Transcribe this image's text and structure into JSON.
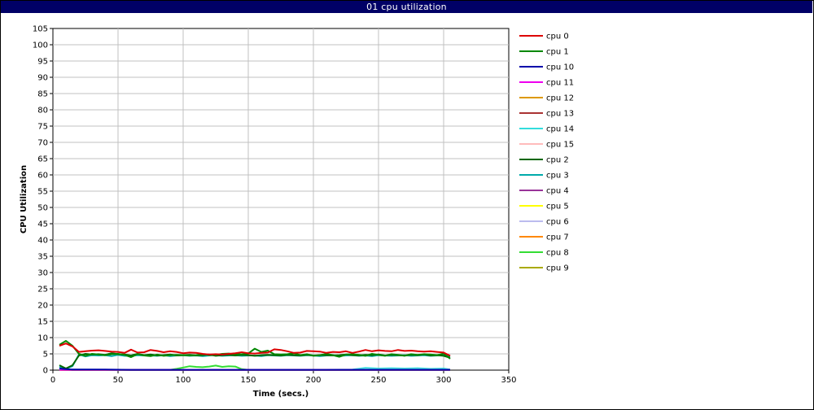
{
  "window": {
    "title": "01 cpu utilization"
  },
  "chart_data": {
    "type": "line",
    "title": "01 cpu utilization",
    "xlabel": "Time (secs.)",
    "ylabel": "CPU Utilization",
    "xlim": [
      0,
      350
    ],
    "ylim": [
      0,
      105
    ],
    "xticks": [
      0,
      50,
      100,
      150,
      200,
      250,
      300,
      350
    ],
    "yticks": [
      0,
      5,
      10,
      15,
      20,
      25,
      30,
      35,
      40,
      45,
      50,
      55,
      60,
      65,
      70,
      75,
      80,
      85,
      90,
      95,
      100,
      105
    ],
    "grid": true,
    "legend_position": "right",
    "series": [
      {
        "name": "cpu 0",
        "color": "#dd0000",
        "x": [
          5,
          10,
          15,
          20,
          25,
          30,
          35,
          40,
          45,
          50,
          55,
          60,
          65,
          70,
          75,
          80,
          85,
          90,
          95,
          100,
          105,
          110,
          115,
          120,
          125,
          130,
          135,
          140,
          145,
          150,
          155,
          160,
          165,
          170,
          175,
          180,
          185,
          190,
          195,
          200,
          205,
          210,
          215,
          220,
          225,
          230,
          235,
          240,
          245,
          250,
          255,
          260,
          265,
          270,
          275,
          280,
          285,
          290,
          295,
          300,
          305
        ],
        "y": [
          7.5,
          8.2,
          7.3,
          5.6,
          5.8,
          6.0,
          6.1,
          5.9,
          5.7,
          5.6,
          5.3,
          6.3,
          5.4,
          5.5,
          6.2,
          5.9,
          5.5,
          5.8,
          5.6,
          5.2,
          5.4,
          5.3,
          5.0,
          4.8,
          4.9,
          4.8,
          5.0,
          5.2,
          5.5,
          5.2,
          5.1,
          5.3,
          5.4,
          6.4,
          6.2,
          5.8,
          5.3,
          5.4,
          5.9,
          5.8,
          5.7,
          5.3,
          5.6,
          5.5,
          5.8,
          5.3,
          5.7,
          6.2,
          5.8,
          6.1,
          5.9,
          5.8,
          6.2,
          5.9,
          6.0,
          5.8,
          5.7,
          5.8,
          5.6,
          5.4,
          4.4
        ]
      },
      {
        "name": "cpu 1",
        "color": "#008800",
        "x": [
          5,
          10,
          15,
          20,
          25,
          30,
          35,
          40,
          45,
          50,
          55,
          60,
          65,
          70,
          75,
          80,
          85,
          90,
          95,
          100,
          105,
          110,
          115,
          120,
          125,
          130,
          135,
          140,
          145,
          150,
          155,
          160,
          165,
          170,
          175,
          180,
          185,
          190,
          195,
          200,
          205,
          210,
          215,
          220,
          225,
          230,
          235,
          240,
          245,
          250,
          255,
          260,
          265,
          270,
          275,
          280,
          285,
          290,
          295,
          300,
          305
        ],
        "y": [
          7.8,
          9.0,
          7.5,
          5.0,
          4.4,
          5.0,
          4.8,
          4.6,
          4.9,
          5.0,
          4.7,
          4.0,
          4.9,
          4.5,
          4.3,
          4.8,
          4.4,
          4.6,
          4.7,
          4.6,
          4.5,
          4.6,
          4.9,
          4.6,
          4.7,
          5.0,
          5.1,
          4.8,
          4.9,
          5.1,
          6.6,
          5.6,
          6.0,
          4.9,
          4.8,
          4.9,
          5.2,
          4.6,
          4.9,
          4.4,
          4.6,
          5.0,
          4.6,
          4.1,
          4.8,
          4.9,
          4.7,
          4.4,
          5.0,
          4.7,
          4.4,
          4.9,
          4.7,
          4.4,
          4.9,
          4.7,
          4.9,
          4.8,
          4.6,
          5.1,
          3.5
        ]
      },
      {
        "name": "cpu 10",
        "color": "#0000aa",
        "x": [
          5,
          10,
          15,
          20,
          40,
          60,
          80,
          100,
          120,
          140,
          160,
          180,
          200,
          220,
          240,
          260,
          280,
          300,
          305
        ],
        "y": [
          0.5,
          0.3,
          0.2,
          0.2,
          0.2,
          0.1,
          0.1,
          0.1,
          0.1,
          0.1,
          0.1,
          0.1,
          0.1,
          0.1,
          0.1,
          0.1,
          0.1,
          0.1,
          0.1
        ]
      },
      {
        "name": "cpu 11",
        "color": "#ee00ee",
        "x": [
          5,
          305
        ],
        "y": [
          0.1,
          0.1
        ]
      },
      {
        "name": "cpu 12",
        "color": "#dd9900",
        "x": [
          5,
          305
        ],
        "y": [
          0.1,
          0.1
        ]
      },
      {
        "name": "cpu 13",
        "color": "#aa3333",
        "x": [
          5,
          305
        ],
        "y": [
          0.1,
          0.1
        ]
      },
      {
        "name": "cpu 14",
        "color": "#33dddd",
        "x": [
          5,
          50,
          100,
          150,
          200,
          230,
          240,
          250,
          260,
          270,
          280,
          290,
          300,
          305
        ],
        "y": [
          0.2,
          0.1,
          0.1,
          0.1,
          0.1,
          0.2,
          0.7,
          0.5,
          0.6,
          0.5,
          0.6,
          0.4,
          0.5,
          0.2
        ]
      },
      {
        "name": "cpu 15",
        "color": "#ffbbbb",
        "x": [
          5,
          305
        ],
        "y": [
          0.1,
          0.1
        ]
      },
      {
        "name": "cpu 2",
        "color": "#006600",
        "x": [
          5,
          10,
          15,
          20,
          25,
          30,
          35,
          40,
          45,
          50,
          55,
          60,
          65,
          70,
          75,
          80,
          85,
          90,
          95,
          100,
          105,
          110,
          115,
          120,
          125,
          130,
          135,
          140,
          145,
          150,
          155,
          160,
          165,
          170,
          175,
          180,
          185,
          190,
          195,
          200,
          205,
          210,
          215,
          220,
          225,
          230,
          235,
          240,
          245,
          250,
          255,
          260,
          265,
          270,
          275,
          280,
          285,
          290,
          295,
          300,
          305
        ],
        "y": [
          1.5,
          0.5,
          1.5,
          4.5,
          5.0,
          4.8,
          4.9,
          4.7,
          5.2,
          4.9,
          4.8,
          4.5,
          5.0,
          4.6,
          4.8,
          4.5,
          4.6,
          4.8,
          4.5,
          4.6,
          4.7,
          4.5,
          4.6,
          4.8,
          4.4,
          4.6,
          4.7,
          4.5,
          4.7,
          4.6,
          4.4,
          4.6,
          4.7,
          4.6,
          4.5,
          4.7,
          4.6,
          4.5,
          4.7,
          4.5,
          4.6,
          4.6,
          4.5,
          4.6,
          4.8,
          4.6,
          4.5,
          4.7,
          4.6,
          4.8,
          4.5,
          4.7,
          4.6,
          4.5,
          4.7,
          4.6,
          4.8,
          4.5,
          4.6,
          4.4,
          3.8
        ]
      },
      {
        "name": "cpu 3",
        "color": "#00aaaa",
        "x": [
          5,
          10,
          15,
          20,
          25,
          30,
          35,
          40,
          45,
          50,
          55,
          60,
          65,
          70,
          75,
          80,
          85,
          90,
          95,
          100,
          105,
          110,
          115,
          120,
          125,
          130,
          135,
          140,
          145,
          150,
          155,
          160,
          165,
          170,
          175,
          180,
          185,
          190,
          195,
          200,
          205,
          210,
          215,
          220,
          225,
          230,
          235,
          240,
          245,
          250,
          255,
          260,
          265,
          270,
          275,
          280,
          285,
          290,
          295,
          300,
          305
        ],
        "y": [
          1.0,
          0.5,
          1.2,
          4.8,
          4.2,
          4.6,
          4.5,
          4.6,
          4.3,
          4.7,
          4.4,
          4.4,
          4.6,
          4.5,
          4.5,
          4.4,
          4.6,
          4.3,
          4.5,
          4.6,
          4.4,
          4.5,
          4.3,
          4.5,
          4.6,
          4.4,
          4.5,
          4.6,
          4.4,
          4.5,
          4.5,
          4.3,
          4.6,
          4.5,
          4.4,
          4.6,
          4.5,
          4.4,
          4.6,
          4.5,
          4.3,
          4.5,
          4.6,
          4.4,
          4.5,
          4.6,
          4.4,
          4.5,
          4.3,
          4.6,
          4.5,
          4.4,
          4.5,
          4.6,
          4.4,
          4.5,
          4.6,
          4.4,
          4.5,
          4.6,
          4.1
        ]
      },
      {
        "name": "cpu 4",
        "color": "#993399",
        "x": [
          5,
          305
        ],
        "y": [
          0.1,
          0.1
        ]
      },
      {
        "name": "cpu 5",
        "color": "#ffff00",
        "x": [
          5,
          305
        ],
        "y": [
          0.1,
          0.1
        ]
      },
      {
        "name": "cpu 6",
        "color": "#bbbbee",
        "x": [
          5,
          305
        ],
        "y": [
          0.1,
          0.1
        ]
      },
      {
        "name": "cpu 7",
        "color": "#ff8800",
        "x": [
          5,
          305
        ],
        "y": [
          0.1,
          0.1
        ]
      },
      {
        "name": "cpu 8",
        "color": "#33dd33",
        "x": [
          5,
          50,
          90,
          95,
          100,
          105,
          110,
          115,
          120,
          125,
          130,
          135,
          140,
          145,
          150,
          200,
          305
        ],
        "y": [
          0.1,
          0.1,
          0.1,
          0.4,
          0.8,
          1.2,
          1.0,
          0.9,
          1.1,
          1.4,
          1.0,
          1.2,
          1.1,
          0.3,
          0.1,
          0.1,
          0.1
        ]
      },
      {
        "name": "cpu 9",
        "color": "#aaaa00",
        "x": [
          5,
          305
        ],
        "y": [
          0.1,
          0.1
        ]
      }
    ]
  }
}
